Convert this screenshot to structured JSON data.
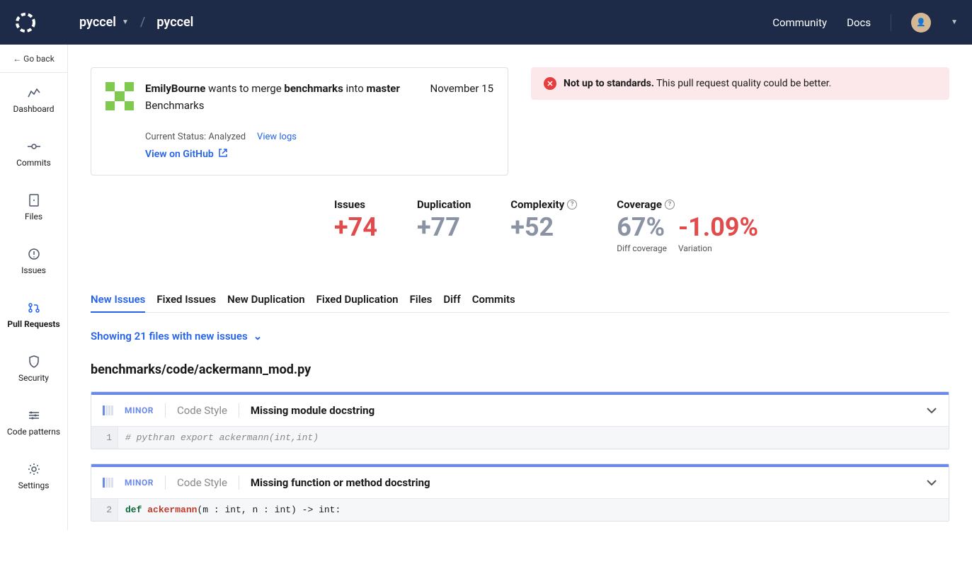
{
  "topnav": {
    "org": "pyccel",
    "repo": "pyccel",
    "links": {
      "community": "Community",
      "docs": "Docs"
    }
  },
  "sidebar": {
    "goback": "← Go back",
    "items": [
      {
        "label": "Dashboard"
      },
      {
        "label": "Commits"
      },
      {
        "label": "Files"
      },
      {
        "label": "Issues"
      },
      {
        "label": "Pull Requests"
      },
      {
        "label": "Security"
      },
      {
        "label": "Code patterns"
      },
      {
        "label": "Settings"
      }
    ]
  },
  "pr": {
    "author": "EmilyBourne",
    "merge_mid": " wants to merge ",
    "branch_from": "benchmarks",
    "merge_into": " into ",
    "branch_to": "master",
    "date": "November 15",
    "title": "Benchmarks",
    "status_prefix": "Current Status: ",
    "status_value": "Analyzed",
    "view_logs": "View logs",
    "view_github": "View on GitHub"
  },
  "alert": {
    "strong": "Not up to standards.",
    "rest": " This pull request quality could be better."
  },
  "metrics": {
    "issues": {
      "label": "Issues",
      "value": "+74"
    },
    "duplication": {
      "label": "Duplication",
      "value": "+77"
    },
    "complexity": {
      "label": "Complexity",
      "value": "+52"
    },
    "coverage": {
      "label": "Coverage",
      "diff_value": "67%",
      "diff_sub": "Diff coverage",
      "var_value": "-1.09%",
      "var_sub": "Variation"
    }
  },
  "tabs": [
    "New Issues",
    "Fixed Issues",
    "New Duplication",
    "Fixed Duplication",
    "Files",
    "Diff",
    "Commits"
  ],
  "filter": "Showing 21 files with new issues",
  "file": {
    "path": "benchmarks/code/ackermann_mod.py",
    "issues": [
      {
        "severity": "MINOR",
        "category": "Code Style",
        "message": "Missing module docstring",
        "line": "1",
        "code_comment": "# pythran export ackermann(int,int)"
      },
      {
        "severity": "MINOR",
        "category": "Code Style",
        "message": "Missing function or method docstring",
        "line": "2",
        "code_kw": "def ",
        "code_fn": "ackermann",
        "code_rest": "(m : int, n : int) -> int:"
      }
    ]
  }
}
